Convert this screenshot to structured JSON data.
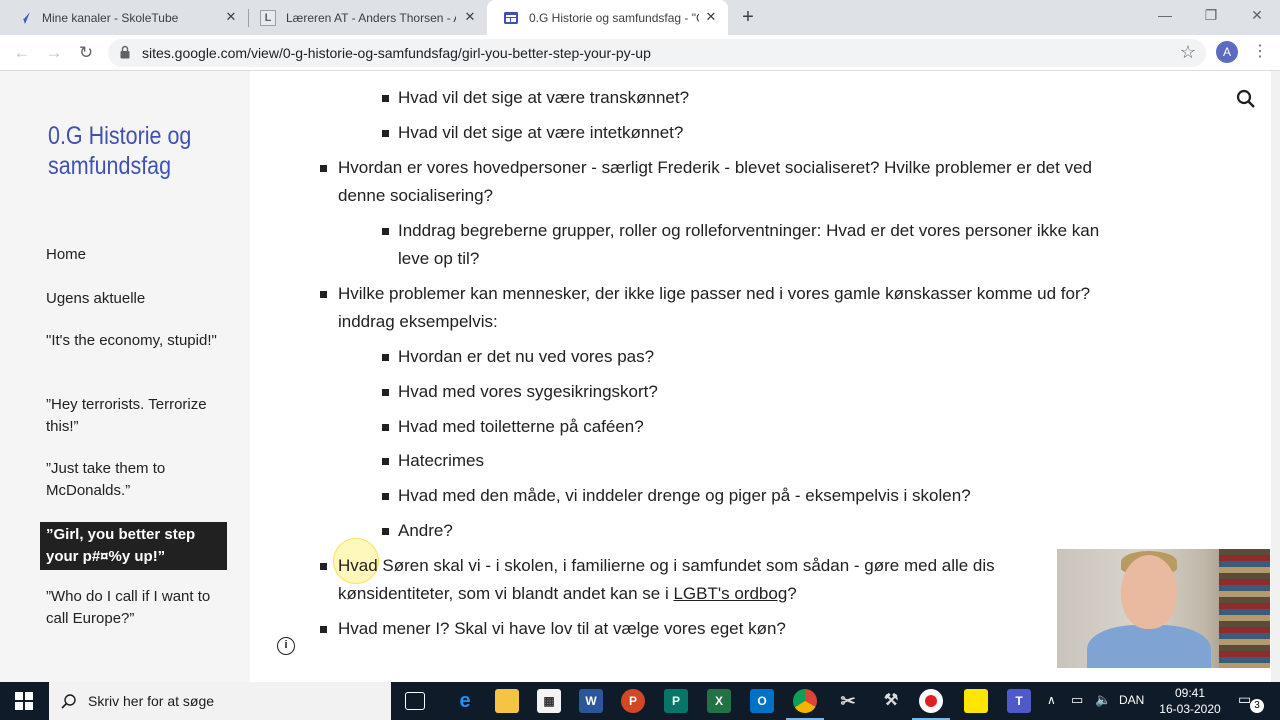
{
  "browser": {
    "tabs": [
      {
        "title": "Mine kanaler - SkoleTube",
        "icon": "skoletube-icon"
      },
      {
        "title": "Læreren AT - Anders Thorsen - A",
        "icon": "laereren-icon"
      },
      {
        "title": "0.G Historie og samfundsfag - \"G",
        "icon": "google-sites-icon"
      }
    ],
    "url": "sites.google.com/view/0-g-historie-og-samfundsfag/girl-you-better-step-your-py-up",
    "avatar_letter": "A"
  },
  "site": {
    "title": "0.G Historie og samfundsfag",
    "nav": [
      "Home",
      "Ugens aktuelle",
      "\"It's the economy, stupid!\"",
      "”Hey terrorists. Terrorize this!”",
      "”Just take them to McDonalds.”",
      "”Girl, you better step your p#¤%y up!”",
      "”Who do I call if I want to call Europe?”"
    ],
    "active_nav_index": 5
  },
  "content": {
    "items": [
      {
        "level": 2,
        "text": "Hvad vil det sige at være transkønnet?"
      },
      {
        "level": 2,
        "text": "Hvad vil det sige at være intetkønnet?"
      },
      {
        "level": 1,
        "line1": "Hvordan er vores hovedpersoner - særligt Frederik - blevet socialiseret? Hvilke problemer er det ved",
        "line2": "denne socialisering?"
      },
      {
        "level": 2,
        "line1": "Inddrag begreberne grupper, roller og rolleforventninger: Hvad er det vores personer ikke kan",
        "line2": "leve op til?"
      },
      {
        "level": 1,
        "line1": "Hvilke problemer kan mennesker, der ikke lige passer ned i vores gamle kønskasser komme ud for?",
        "line2": "inddrag eksempelvis:"
      },
      {
        "level": 2,
        "text": "Hvordan er det nu ved vores pas?"
      },
      {
        "level": 2,
        "text": "Hvad med vores sygesikringskort?"
      },
      {
        "level": 2,
        "text": "Hvad med toiletterne på caféen?"
      },
      {
        "level": 2,
        "text": "Hatecrimes"
      },
      {
        "level": 2,
        "text": "Hvad med den måde, vi inddeler drenge og piger på - eksempelvis i skolen?"
      },
      {
        "level": 2,
        "text": "Andre?"
      },
      {
        "level": 1,
        "line1": "Hvad Søren skal vi - i skolen, i familierne og i samfundet som sådan - gøre med alle dis",
        "line2_pre": "kønsidentiteter, som vi blandt andet kan se i ",
        "link": "LGBT's ordbog",
        "line2_post": "?"
      },
      {
        "level": 1,
        "text": "Hvad mener I? Skal vi have lov til at vælge vores eget køn?"
      }
    ]
  },
  "taskbar": {
    "search_placeholder": "Skriv her for at søge",
    "language": "DAN",
    "time": "09:41",
    "date": "16-03-2020",
    "notification_count": "3"
  }
}
